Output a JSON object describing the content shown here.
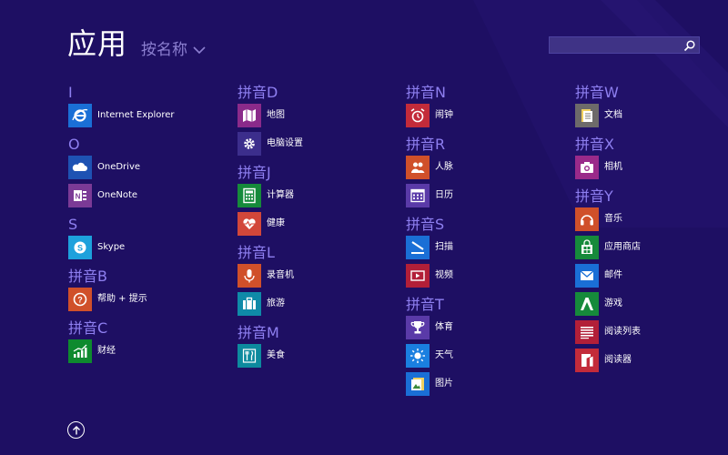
{
  "header": {
    "title": "应用",
    "sort_label": "按名称"
  },
  "search": {
    "placeholder": ""
  },
  "columns": [
    {
      "groups": [
        {
          "letter": "I",
          "items": [
            {
              "label": "Internet Explorer",
              "icon": "internet-explorer-icon",
              "color": "#1a6fd6"
            }
          ]
        },
        {
          "letter": "O",
          "items": [
            {
              "label": "OneDrive",
              "icon": "onedrive-icon",
              "color": "#1e52b3"
            },
            {
              "label": "OneNote",
              "icon": "onenote-icon",
              "color": "#7b3a96"
            }
          ]
        },
        {
          "letter": "S",
          "items": [
            {
              "label": "Skype",
              "icon": "skype-icon",
              "color": "#1da1dc"
            }
          ]
        },
        {
          "letter": "拼音B",
          "items": [
            {
              "label": "帮助 + 提示",
              "icon": "help-tips-icon",
              "color": "#d0502a"
            }
          ]
        },
        {
          "letter": "拼音C",
          "items": [
            {
              "label": "财经",
              "icon": "finance-icon",
              "color": "#0e8a2e"
            }
          ]
        }
      ]
    },
    {
      "groups": [
        {
          "letter": "拼音D",
          "items": [
            {
              "label": "地图",
              "icon": "maps-icon",
              "color": "#8a2a8a"
            },
            {
              "label": "电脑设置",
              "icon": "settings-icon",
              "color": "#3c2e8c"
            }
          ]
        },
        {
          "letter": "拼音J",
          "items": [
            {
              "label": "计算器",
              "icon": "calculator-icon",
              "color": "#168a3b"
            },
            {
              "label": "健康",
              "icon": "health-icon",
              "color": "#d2473a"
            }
          ]
        },
        {
          "letter": "拼音L",
          "items": [
            {
              "label": "录音机",
              "icon": "sound-recorder-icon",
              "color": "#d0502a"
            },
            {
              "label": "旅游",
              "icon": "travel-icon",
              "color": "#0f8aa8"
            }
          ]
        },
        {
          "letter": "拼音M",
          "items": [
            {
              "label": "美食",
              "icon": "food-icon",
              "color": "#0d8a9e"
            }
          ]
        }
      ]
    },
    {
      "groups": [
        {
          "letter": "拼音N",
          "items": [
            {
              "label": "闹钟",
              "icon": "alarm-icon",
              "color": "#c32b3a"
            }
          ]
        },
        {
          "letter": "拼音R",
          "items": [
            {
              "label": "人脉",
              "icon": "people-icon",
              "color": "#d0502a"
            },
            {
              "label": "日历",
              "icon": "calendar-icon",
              "color": "#5a3aa8"
            }
          ]
        },
        {
          "letter": "拼音S",
          "items": [
            {
              "label": "扫描",
              "icon": "scan-icon",
              "color": "#1a6fd6"
            },
            {
              "label": "视频",
              "icon": "video-icon",
              "color": "#b21f38"
            }
          ]
        },
        {
          "letter": "拼音T",
          "items": [
            {
              "label": "体育",
              "icon": "sports-icon",
              "color": "#5a3aa8"
            },
            {
              "label": "天气",
              "icon": "weather-icon",
              "color": "#1a7fe0"
            },
            {
              "label": "图片",
              "icon": "photos-icon",
              "color": "#1a6fd6"
            }
          ]
        }
      ]
    },
    {
      "groups": [
        {
          "letter": "拼音W",
          "items": [
            {
              "label": "文档",
              "icon": "documents-icon",
              "color": "#6d6a6a"
            }
          ]
        },
        {
          "letter": "拼音X",
          "items": [
            {
              "label": "相机",
              "icon": "camera-icon",
              "color": "#9a2a8a"
            }
          ]
        },
        {
          "letter": "拼音Y",
          "items": [
            {
              "label": "音乐",
              "icon": "music-icon",
              "color": "#d0502a"
            },
            {
              "label": "应用商店",
              "icon": "store-icon",
              "color": "#168a3b"
            },
            {
              "label": "邮件",
              "icon": "mail-icon",
              "color": "#1a6fd6"
            },
            {
              "label": "游戏",
              "icon": "games-icon",
              "color": "#168a3b"
            },
            {
              "label": "阅读列表",
              "icon": "reading-list-icon",
              "color": "#b21f38"
            },
            {
              "label": "阅读器",
              "icon": "reader-icon",
              "color": "#c32b3a"
            }
          ]
        }
      ]
    }
  ],
  "colors": {
    "background": "#1e0f63",
    "group_header": "#8e7ff0",
    "sort_label": "#8c7fd0"
  }
}
